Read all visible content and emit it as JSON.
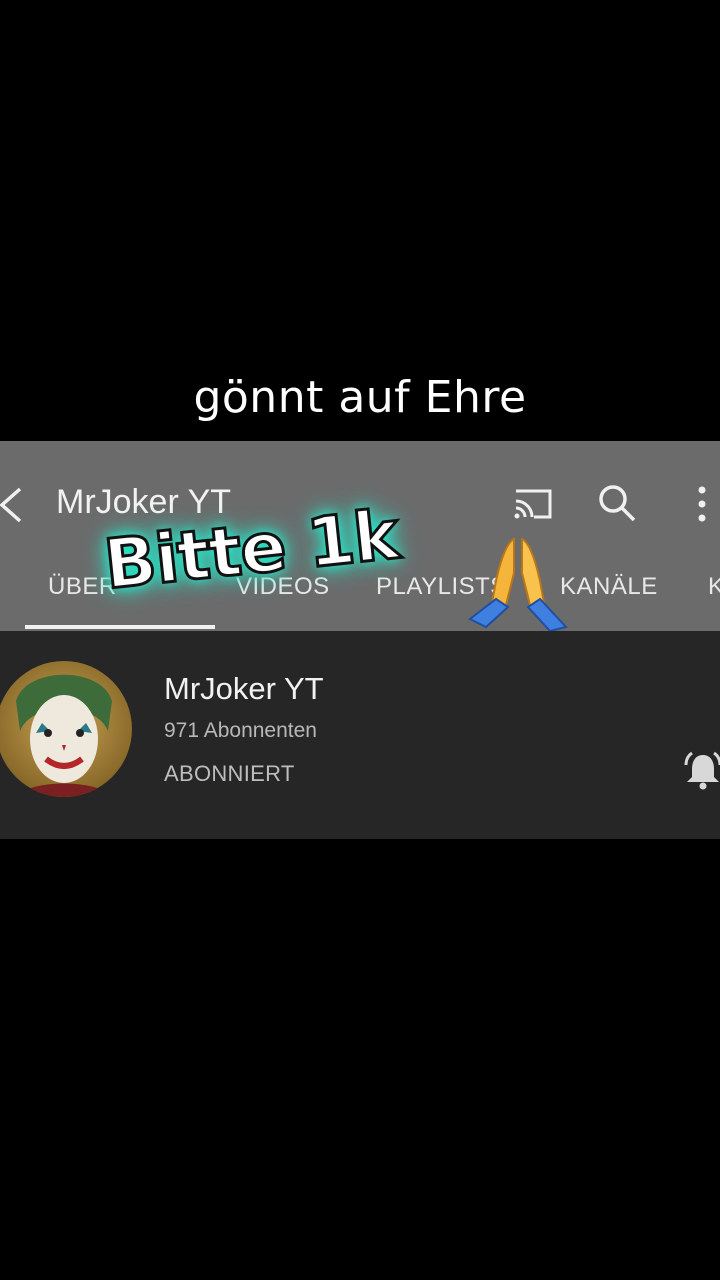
{
  "caption": "gönnt auf Ehre",
  "appbar": {
    "title": "MrJoker YT",
    "icons": [
      "back-icon",
      "cast-icon",
      "search-icon",
      "more-icon"
    ]
  },
  "tabs": [
    {
      "label": "ÜBER"
    },
    {
      "label": "VIDEOS"
    },
    {
      "label": "PLAYLISTS"
    },
    {
      "label": "KANÄLE"
    },
    {
      "label": "K"
    }
  ],
  "overlay": {
    "text": "Bitte 1k",
    "emoji": "folded-hands-icon",
    "glow_color": "#2ce3c6"
  },
  "channel": {
    "name": "MrJoker YT",
    "subscribers": "971 Abonnenten",
    "status": "ABONNIERT",
    "bell_icon": "bell-icon"
  },
  "colors": {
    "appbar_bg": "#6b6b6b",
    "panel_bg": "#262626",
    "background": "#000000"
  }
}
